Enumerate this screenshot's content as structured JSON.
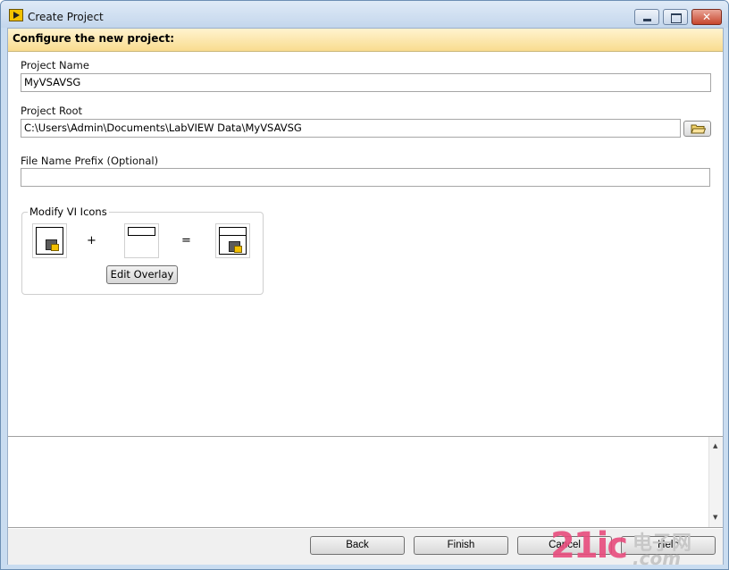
{
  "window": {
    "title": "Create Project"
  },
  "header": {
    "title": "Configure the new project:"
  },
  "form": {
    "project_name": {
      "label": "Project Name",
      "value": "MyVSAVSG"
    },
    "project_root": {
      "label": "Project Root",
      "value": "C:\\Users\\Admin\\Documents\\LabVIEW Data\\MyVSAVSG"
    },
    "file_prefix": {
      "label": "File Name Prefix (Optional)",
      "value": ""
    }
  },
  "icons_group": {
    "title": "Modify VI Icons",
    "plus": "+",
    "equals": "=",
    "edit_overlay_label": "Edit Overlay"
  },
  "footer": {
    "back_label": "Back",
    "finish_label": "Finish",
    "cancel_label": "Cancel",
    "help_label": "Help"
  },
  "watermark": {
    "big": "21ic",
    "cn": "电子网",
    "com": ".com"
  }
}
